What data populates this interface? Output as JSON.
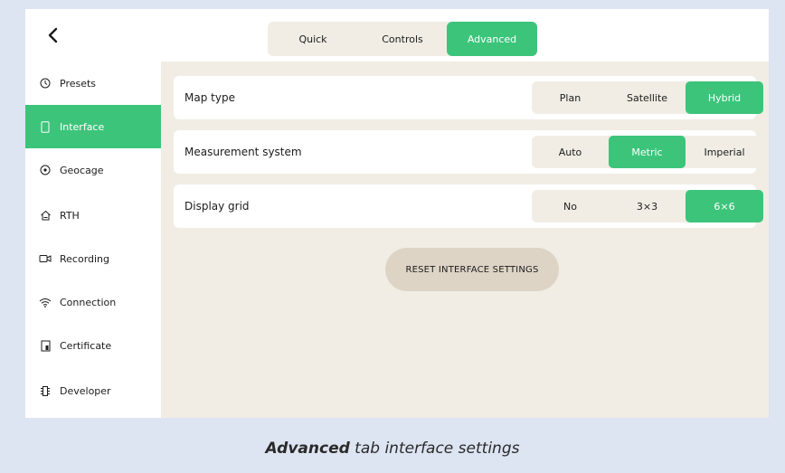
{
  "header": {
    "back_icon": "chevron-left-icon",
    "tabs": [
      {
        "label": "Quick",
        "active": false
      },
      {
        "label": "Controls",
        "active": false
      },
      {
        "label": "Advanced",
        "active": true
      }
    ]
  },
  "sidebar": {
    "items": [
      {
        "label": "Presets",
        "icon": "clock-icon",
        "active": false
      },
      {
        "label": "Interface",
        "icon": "phone-icon",
        "active": true
      },
      {
        "label": "Geocage",
        "icon": "target-icon",
        "active": false
      },
      {
        "label": "RTH",
        "icon": "home-icon",
        "active": false
      },
      {
        "label": "Recording",
        "icon": "camera-icon",
        "active": false
      },
      {
        "label": "Connection",
        "icon": "wifi-icon",
        "active": false
      },
      {
        "label": "Certificate",
        "icon": "certificate-icon",
        "active": false
      },
      {
        "label": "Developer",
        "icon": "chip-icon",
        "active": false
      }
    ]
  },
  "settings": {
    "map_type": {
      "label": "Map type",
      "options": [
        "Plan",
        "Satellite",
        "Hybrid"
      ],
      "selected": "Hybrid"
    },
    "measurement": {
      "label": "Measurement system",
      "options": [
        "Auto",
        "Metric",
        "Imperial"
      ],
      "selected": "Metric"
    },
    "grid": {
      "label": "Display grid",
      "options": [
        "No",
        "3×3",
        "6×6"
      ],
      "selected": "6×6"
    }
  },
  "reset_label": "RESET INTERFACE SETTINGS",
  "caption": {
    "bold": "Advanced",
    "rest": " tab interface settings"
  },
  "colors": {
    "accent": "#3dc47b",
    "panel": "#f1ede4",
    "outer": "#dde4f2"
  }
}
